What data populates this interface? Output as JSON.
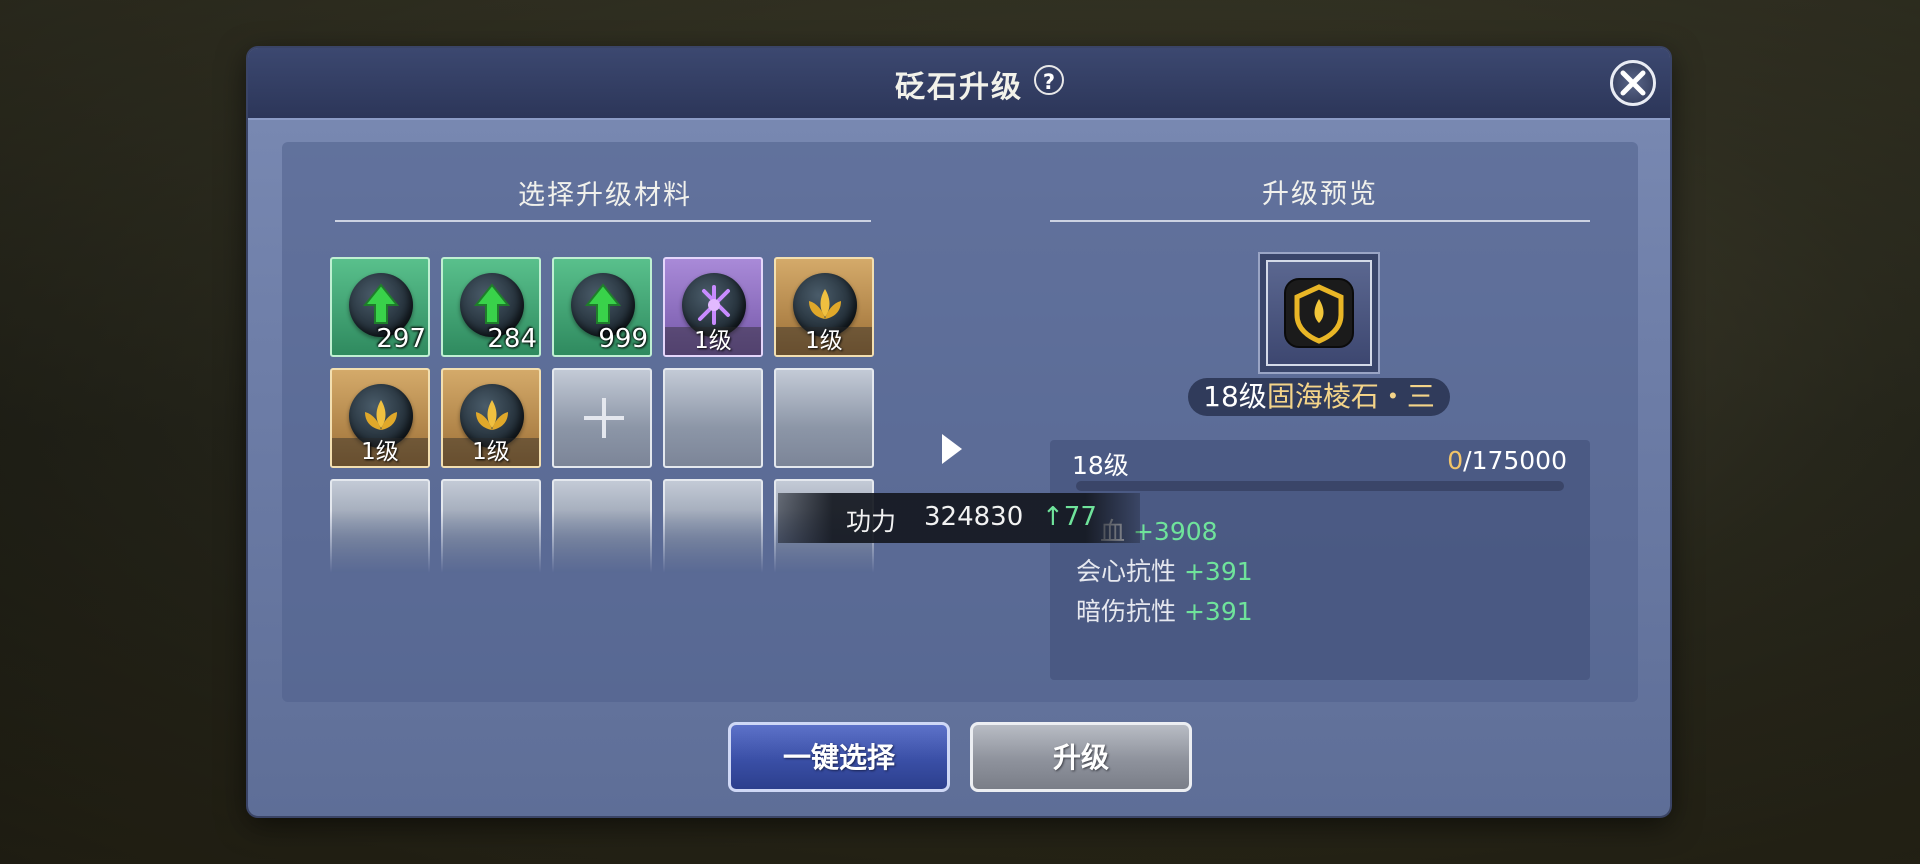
{
  "dialog": {
    "title": "砭石升级",
    "help_glyph": "?"
  },
  "materials": {
    "title": "选择升级材料",
    "slots": [
      {
        "type": "green",
        "icon": "green-arrow-gem-icon",
        "count": "297"
      },
      {
        "type": "green",
        "icon": "green-arrow-gem-icon",
        "count": "284"
      },
      {
        "type": "green",
        "icon": "green-arrow-gem-icon",
        "count": "999"
      },
      {
        "type": "purple",
        "icon": "purple-rune-gem-icon",
        "level": "1级"
      },
      {
        "type": "gold",
        "icon": "lotus-gem-icon",
        "level": "1级"
      },
      {
        "type": "gold",
        "icon": "lotus-gem-icon",
        "level": "1级"
      },
      {
        "type": "gold",
        "icon": "lotus-gem-icon",
        "level": "1级"
      },
      {
        "type": "add"
      }
    ]
  },
  "preview": {
    "title": "升级预览",
    "item_level": "18级",
    "item_name": "固海棱石・三",
    "level_label": "18级",
    "exp_current": "0",
    "exp_total": "/175000",
    "stats": [
      {
        "label": "血",
        "value": "+3908"
      },
      {
        "label": "会心抗性",
        "value": "+391"
      },
      {
        "label": "暗伤抗性",
        "value": "+391"
      }
    ]
  },
  "power_tip": {
    "label": "功力",
    "value": "324830",
    "up_arrow": "↑",
    "delta": "77"
  },
  "buttons": {
    "auto_select": "一键选择",
    "upgrade": "升级"
  },
  "colors": {
    "accent_gold": "#f4d489",
    "stat_green": "#6fe39b",
    "exp_gold": "#f2c468"
  }
}
